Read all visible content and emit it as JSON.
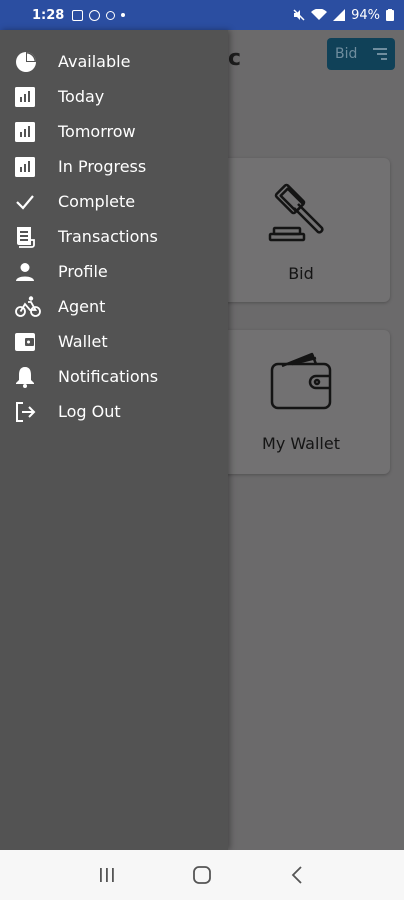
{
  "status_bar": {
    "time": "1:28",
    "battery": "94%"
  },
  "app": {
    "title_fragment": "c",
    "header_button_label": "Bid",
    "cards": [
      {
        "label": "Bid",
        "icon": "gavel-icon"
      },
      {
        "label": "My Wallet",
        "icon": "wallet-icon"
      }
    ]
  },
  "drawer": {
    "items": [
      {
        "label": "Available",
        "icon": "pie-chart-icon"
      },
      {
        "label": "Today",
        "icon": "bar-chart-icon"
      },
      {
        "label": "Tomorrow",
        "icon": "bar-chart-icon"
      },
      {
        "label": "In Progress",
        "icon": "bar-chart-icon"
      },
      {
        "label": "Complete",
        "icon": "check-icon"
      },
      {
        "label": "Transactions",
        "icon": "receipt-icon"
      },
      {
        "label": "Profile",
        "icon": "person-icon"
      },
      {
        "label": "Agent",
        "icon": "bicycle-icon"
      },
      {
        "label": "Wallet",
        "icon": "wallet-icon"
      },
      {
        "label": "Notifications",
        "icon": "bell-icon"
      },
      {
        "label": "Log Out",
        "icon": "logout-icon"
      }
    ]
  },
  "colors": {
    "status_bar": "#2b4ea1",
    "drawer_bg": "#535353",
    "scrim_bg": "#6b6a6b",
    "header_button": "#104158"
  }
}
